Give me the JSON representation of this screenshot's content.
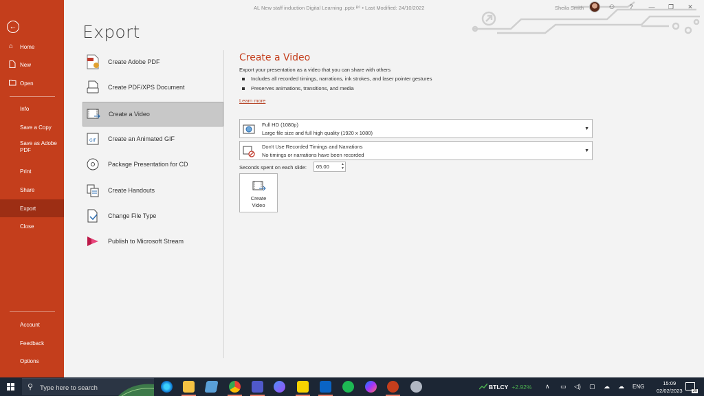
{
  "window": {
    "doc_title": "AL New staff induction Digital Learning .pptx",
    "saved_indicator": "ᴿ⁰",
    "last_modified": "• Last Modified: 24/10/2022",
    "user_name": "Sheila Smith",
    "help_label": "?",
    "minimize_label": "—",
    "restore_label": "❐",
    "close_label": "✕"
  },
  "sidebar": {
    "back_label": "←",
    "items": [
      {
        "label": "Home",
        "icon": "⌂"
      },
      {
        "label": "New",
        "icon": "🗋"
      },
      {
        "label": "Open",
        "icon": "📂"
      },
      {
        "label": "Info"
      },
      {
        "label": "Save a Copy"
      },
      {
        "label": "Save as Adobe PDF"
      },
      {
        "label": "Print"
      },
      {
        "label": "Share"
      },
      {
        "label": "Export"
      },
      {
        "label": "Close"
      }
    ],
    "bottom_items": [
      {
        "label": "Account"
      },
      {
        "label": "Feedback"
      },
      {
        "label": "Options"
      }
    ]
  },
  "page_title": "Export",
  "export_options": [
    {
      "label": "Create Adobe PDF"
    },
    {
      "label": "Create PDF/XPS Document"
    },
    {
      "label": "Create a Video"
    },
    {
      "label": "Create an Animated GIF"
    },
    {
      "label": "Package Presentation for CD"
    },
    {
      "label": "Create Handouts"
    },
    {
      "label": "Change File Type"
    },
    {
      "label": "Publish to Microsoft Stream"
    }
  ],
  "video_panel": {
    "title": "Create a Video",
    "description": "Export your presentation as a video that you can share with others",
    "bullets": [
      "Includes all recorded timings, narrations, ink strokes, and laser pointer gestures",
      "Preserves animations, transitions, and media"
    ],
    "learn_more": "Learn more",
    "quality": {
      "title": "Full HD (1080p)",
      "subtitle": "Large file size and full high quality (1920 x 1080)"
    },
    "timings": {
      "title": "Don't Use Recorded Timings and Narrations",
      "subtitle": "No timings or narrations have been recorded"
    },
    "seconds_label": "Seconds spent on each slide:",
    "seconds_value": "05.00",
    "create_button_line1": "Create",
    "create_button_line2": "Video"
  },
  "taskbar": {
    "search_placeholder": "Type here to search",
    "search_icon": "⚲",
    "ticker_symbol": "BTLCY",
    "ticker_change": "+2.92%",
    "chevron": "∧",
    "language": "ENG",
    "time": "15:09",
    "date": "02/02/2023",
    "notification_count": "30"
  },
  "colors": {
    "accent": "#c43e1c",
    "accent_dark": "#9d2e14",
    "link": "#b7472a",
    "taskbar": "#1c2634"
  }
}
